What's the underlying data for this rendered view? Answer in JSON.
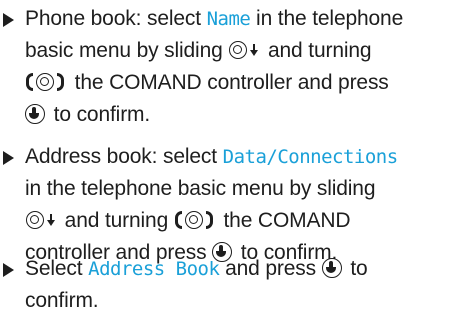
{
  "steps": [
    {
      "lines": [
        {
          "a": "Phone book: select ",
          "disp": "Name",
          "b": " in the telephone"
        },
        {
          "a": "basic menu by sliding",
          "b": " and turning"
        },
        {
          "b": " the COMAND controller and press"
        },
        {
          "b": " to confirm."
        }
      ]
    },
    {
      "lines": [
        {
          "a": "Address book: select ",
          "disp": "Data/Connections"
        },
        {
          "a": "in the telephone basic menu by sliding"
        },
        {
          "b": " and turning",
          "c": " the COMAND"
        },
        {
          "a": "controller and press",
          "b": " to confirm."
        }
      ]
    },
    {
      "lines": [
        {
          "a": "Select ",
          "disp": "Address Book",
          "b": " and press",
          "c": " to"
        },
        {
          "a": "confirm."
        }
      ]
    }
  ],
  "icons": {
    "slide_down": "controller-slide-down-icon",
    "turn": "controller-turn-icon",
    "press": "controller-press-icon",
    "bullet": "triangle-bullet-icon"
  },
  "colors": {
    "text": "#1e1e1e",
    "display_text": "#1aa0d8"
  }
}
